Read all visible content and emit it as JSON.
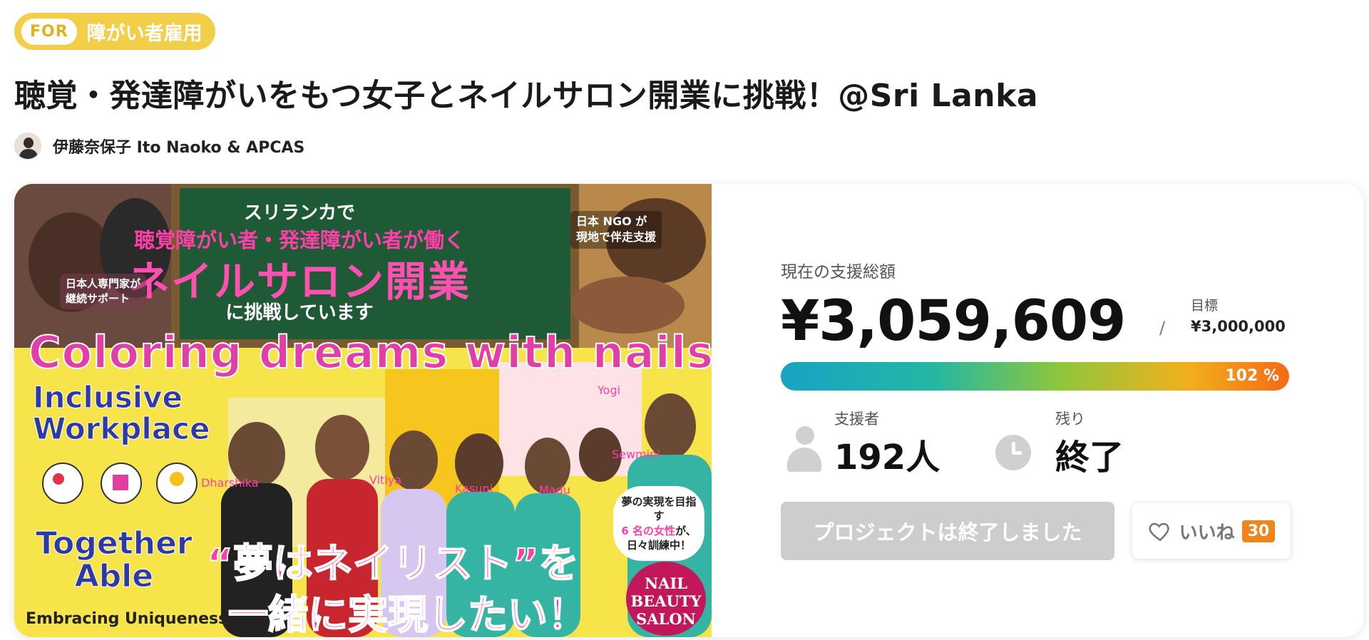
{
  "badge": {
    "prefix": "FOR",
    "label": "障がい者雇用"
  },
  "project": {
    "title": "聴覚・発達障がいをもつ女子とネイルサロン開業に挑戦！@Sri Lanka",
    "owner": "伊藤奈保子 Ito Naoko & APCAS"
  },
  "hero": {
    "board_line1": "スリランカで",
    "board_line2": "聴覚障がい者・発達障がい者が働く",
    "board_line3": "ネイルサロン開業",
    "board_line4": "に挑戦しています",
    "ngo_line1": "日本 NGO が",
    "ngo_line2": "現地で伴走支援",
    "expert_line1": "日本人専門家が",
    "expert_line2": "継続サポート",
    "coloring": "Coloring dreams with nails.",
    "inclusive_line1": "Inclusive",
    "inclusive_line2": "Workplace",
    "together_line1": "Together",
    "together_line2": "Able",
    "embracing": "Embracing Uniqueness",
    "dream_line1": "“夢はネイリスト”を",
    "dream_line2": "一緒に実現したい！",
    "bubble_line1": "夢の実現を目指す",
    "bubble_line2": "6 名の女性",
    "bubble_line2b": "が、",
    "bubble_line3": "日々訓練中！",
    "logo_line1": "NAIL",
    "logo_line2": "BEAUTY",
    "logo_line3": "SALON",
    "names": [
      "Dharshika",
      "Vitiya",
      "Kasuni",
      "Madu",
      "Sewmini",
      "Yogi"
    ]
  },
  "funding": {
    "amount_label": "現在の支援総額",
    "amount": "¥3,059,609",
    "slash": "/",
    "goal_label": "目標",
    "goal": "¥3,000,000",
    "progress_percent": 102,
    "progress_text": "102 %",
    "supporters_label": "支援者",
    "supporters": "192人",
    "remaining_label": "残り",
    "remaining": "終了"
  },
  "actions": {
    "ended_button": "プロジェクトは終了しました",
    "like_label": "いいね",
    "like_count": "30"
  },
  "colors": {
    "badge_bg": "#f3cf49",
    "progress_start": "#17a3c4",
    "progress_end": "#f46a16",
    "like_count_bg": "#f0861b",
    "disabled_button": "#cdcdcd"
  }
}
